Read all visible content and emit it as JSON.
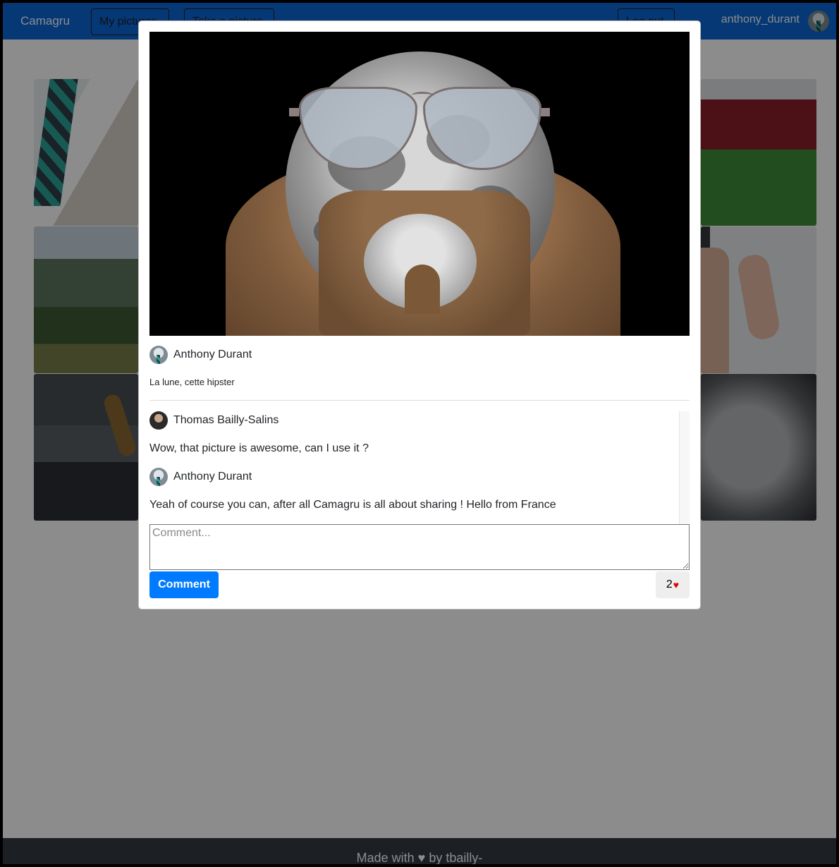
{
  "navbar": {
    "brand": "Camagru",
    "my_pictures": "My pictures",
    "take_picture": "Take a picture",
    "logout": "Log out",
    "username": "anthony_durant"
  },
  "footer": {
    "text": "Made with ♥ by tbailly-"
  },
  "modal": {
    "author": "Anthony Durant",
    "caption": "La lune, cette hipster",
    "comments": [
      {
        "author": "Thomas Bailly-Salins",
        "text": "Wow, that picture is awesome, can I use it ?"
      },
      {
        "author": "Anthony Durant",
        "text": "Yeah of course you can, after all Camagru is all about sharing ! Hello from France"
      }
    ],
    "comment_placeholder": "Comment...",
    "comment_button": "Comment",
    "like_count": "2",
    "heart_icon": "♥"
  }
}
